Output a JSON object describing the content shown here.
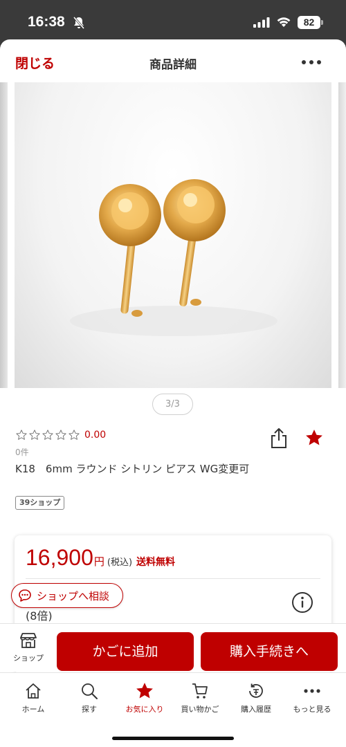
{
  "status_bar": {
    "time": "16:38",
    "battery": "82"
  },
  "nav": {
    "close_label": "閉じる",
    "title": "商品詳細"
  },
  "gallery": {
    "page_indicator": "3/3"
  },
  "product": {
    "rating_stars": 0,
    "rating_score": "0.00",
    "review_count": "0件",
    "title": "K18　6mm ラウンド シトリン ピアス WG変更可",
    "shop_badge": "39ショップ",
    "favorited": true
  },
  "price_card": {
    "price": "16,900",
    "yen": "円",
    "tax": "(税込)",
    "shipping": "送料無料",
    "points_partial": "(8倍)"
  },
  "consult_button": {
    "label": "ショップへ相談"
  },
  "action_bar": {
    "shop_label": "ショップ",
    "add_to_cart": "かごに追加",
    "checkout": "購入手続きへ"
  },
  "tab_bar": {
    "tabs": [
      {
        "label": "ホーム",
        "icon": "home-icon"
      },
      {
        "label": "探す",
        "icon": "search-icon"
      },
      {
        "label": "お気に入り",
        "icon": "star-icon"
      },
      {
        "label": "買い物かご",
        "icon": "cart-icon"
      },
      {
        "label": "購入履歴",
        "icon": "history-icon"
      },
      {
        "label": "もっと見る",
        "icon": "more-icon"
      }
    ],
    "active_tab": "お気に入り"
  },
  "colors": {
    "brand_red": "#bf0000",
    "text": "#333333",
    "muted": "#999999"
  }
}
